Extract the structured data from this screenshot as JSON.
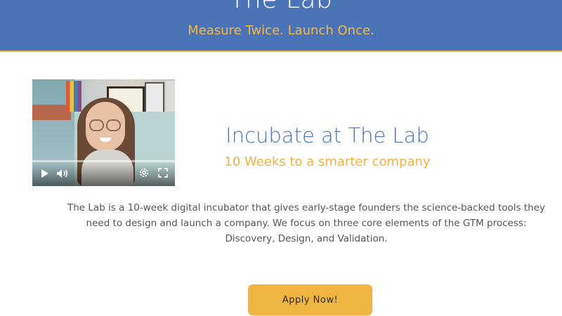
{
  "header": {
    "title": "The Lab",
    "tagline": "Measure Twice. Launch Once."
  },
  "video": {
    "icons": [
      "play-icon",
      "volume-icon",
      "settings-icon",
      "fullscreen-icon"
    ]
  },
  "main": {
    "title": "Incubate at The Lab",
    "subtitle": "10 Weeks to a smarter company",
    "description": "The Lab is a 10-week digital incubator that gives early-stage founders the science-backed tools they need to design and launch a company. We focus on three core elements of the GTM process: Discovery, Design, and Validation.",
    "cta_label": "Apply Now!"
  },
  "colors": {
    "header_bg": "#4a73b8",
    "accent": "#f0b440",
    "title_blue": "#4a73b8",
    "body_text": "#555555"
  }
}
